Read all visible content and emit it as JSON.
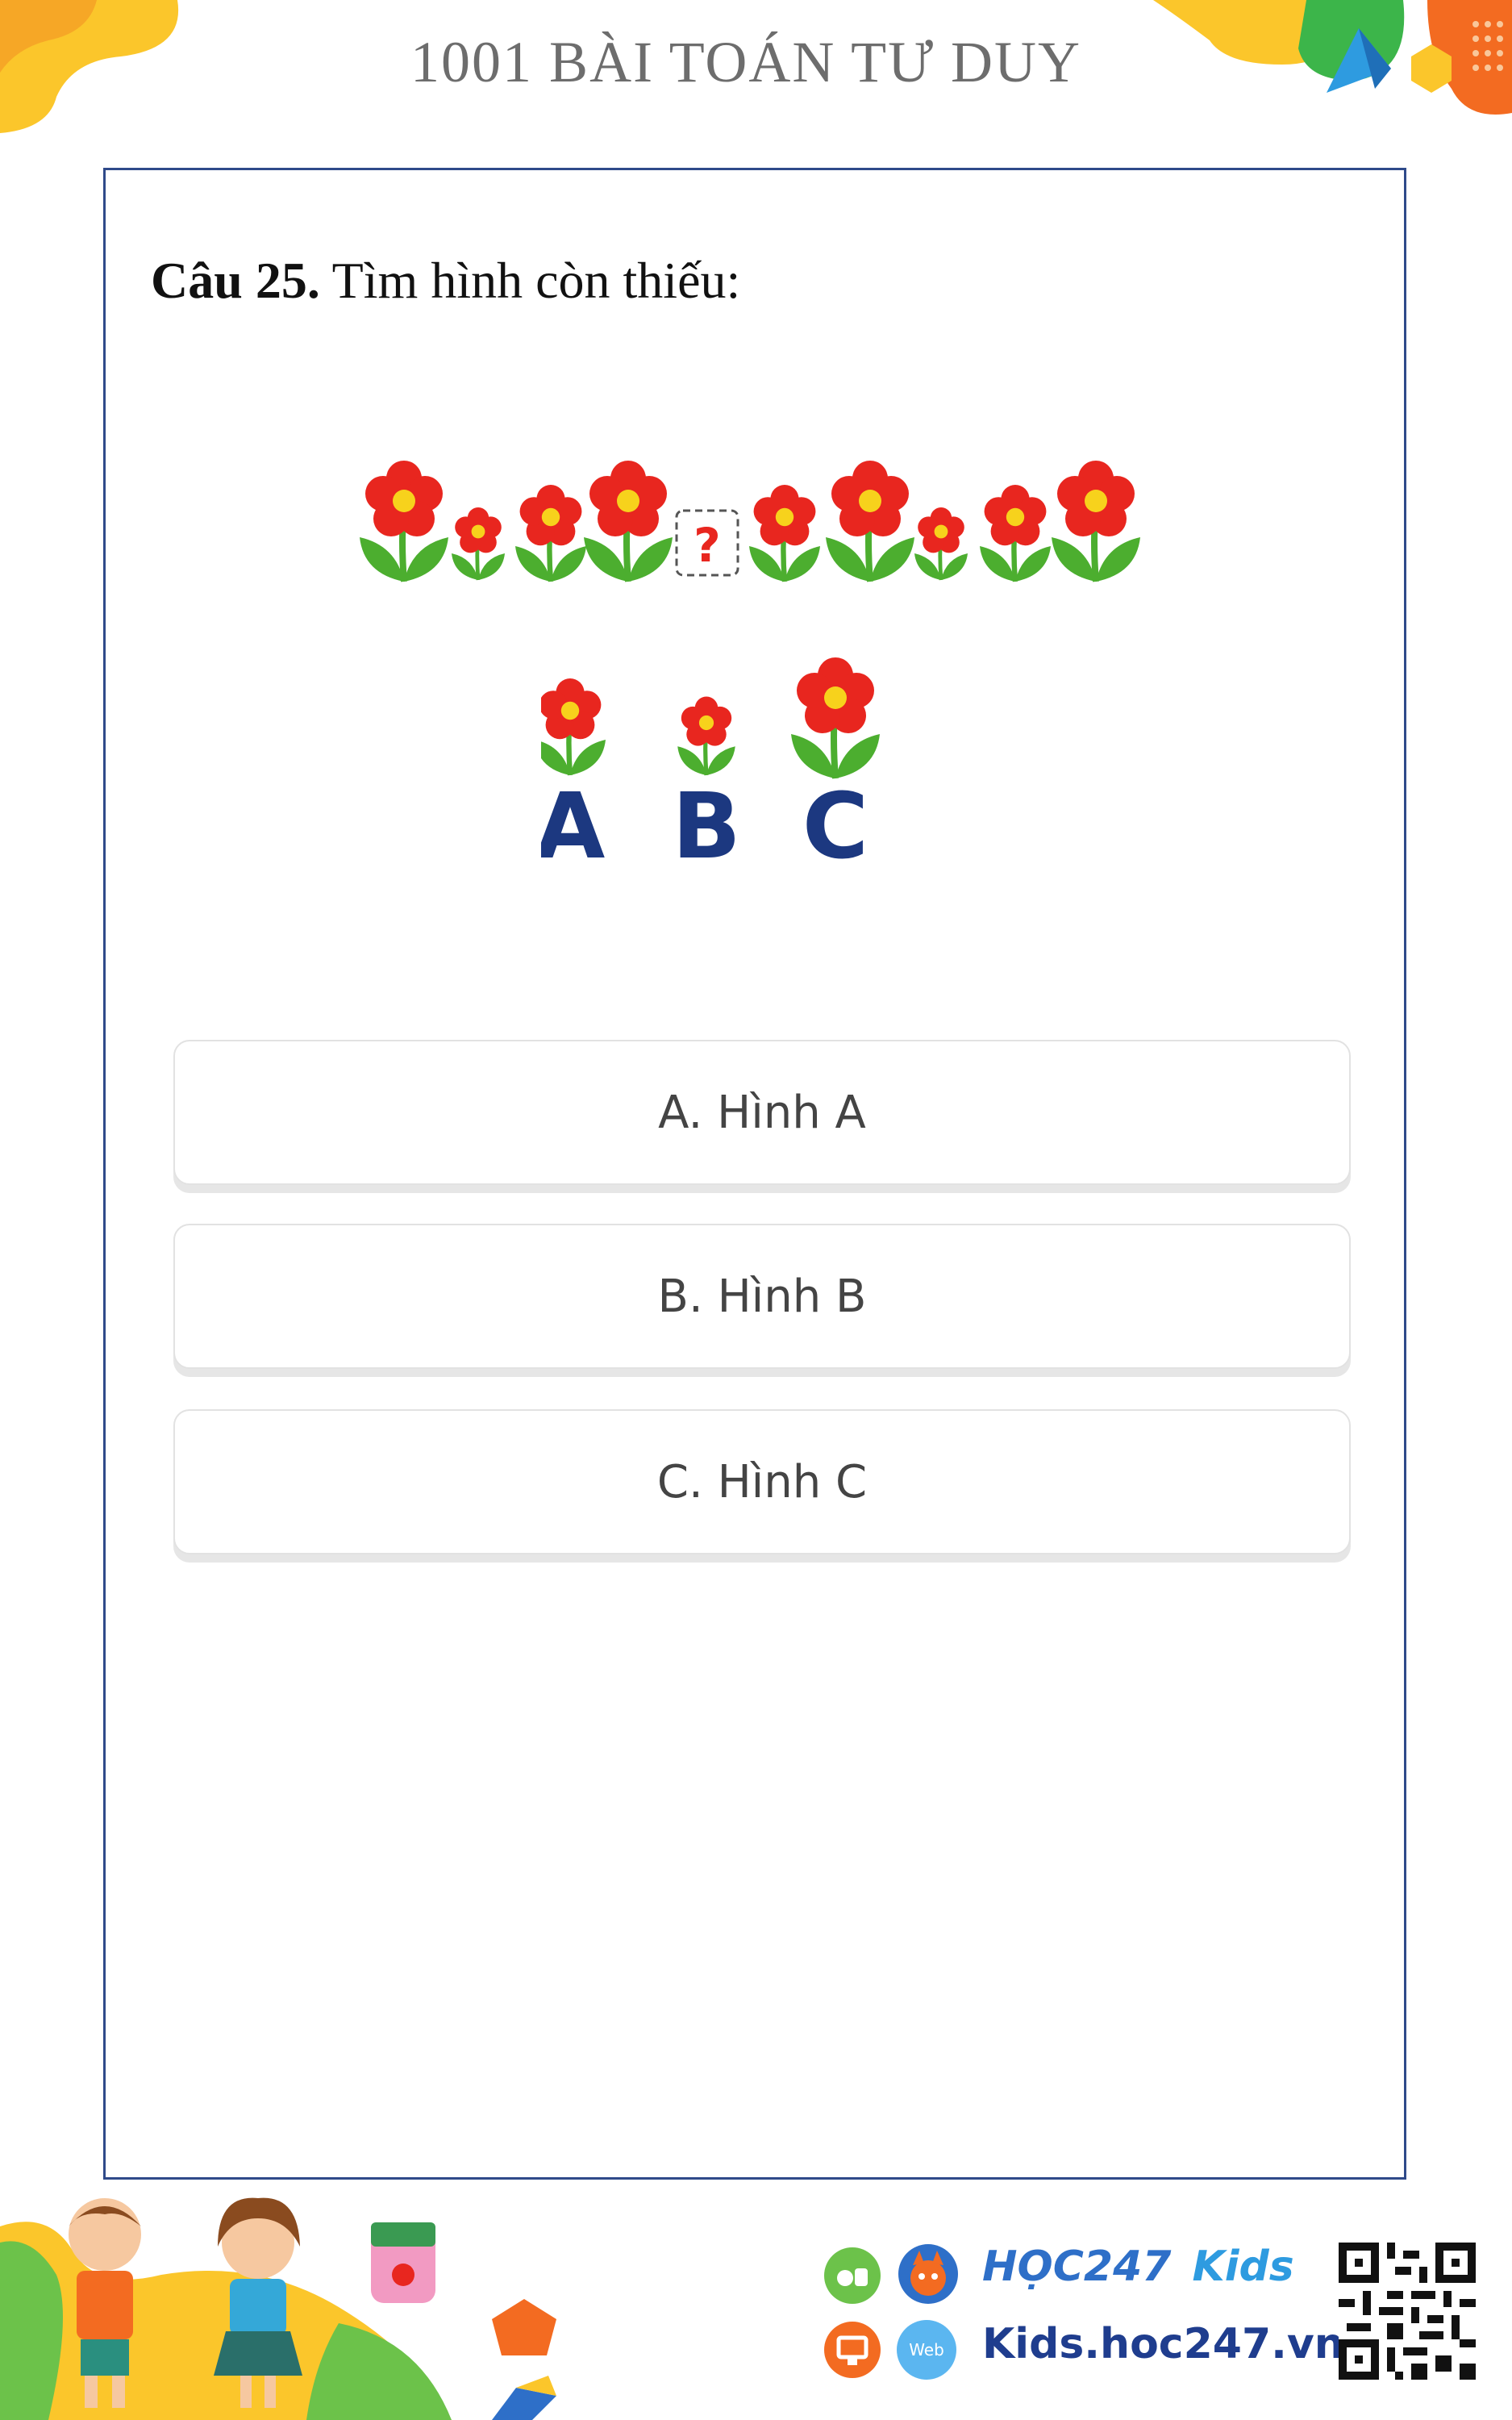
{
  "header": {
    "title": "1001 BÀI TOÁN TƯ DUY"
  },
  "question": {
    "number": "Câu 25.",
    "text": "Tìm hình còn thiếu:"
  },
  "puzzle": {
    "missing_mark": "?",
    "sequence_sizes": [
      "big",
      "small",
      "medium",
      "big",
      "missing",
      "medium",
      "big",
      "small",
      "medium",
      "big"
    ]
  },
  "choices": [
    {
      "letter": "A",
      "size": "medium"
    },
    {
      "letter": "B",
      "size": "small"
    },
    {
      "letter": "C",
      "size": "big"
    }
  ],
  "answers": [
    {
      "label": "A. Hình A"
    },
    {
      "label": "B. Hình B"
    },
    {
      "label": "C. Hình C"
    }
  ],
  "footer": {
    "brand_hoc": "HỌC247",
    "brand_kids": "Kids",
    "site": "Kids.hoc247.vn",
    "web_badge": "Web"
  },
  "colors": {
    "petal": "#e8261f",
    "center": "#f7d21c",
    "leaf": "#4cae2f",
    "letters": "#1c3880",
    "border": "#2f4a8a"
  }
}
